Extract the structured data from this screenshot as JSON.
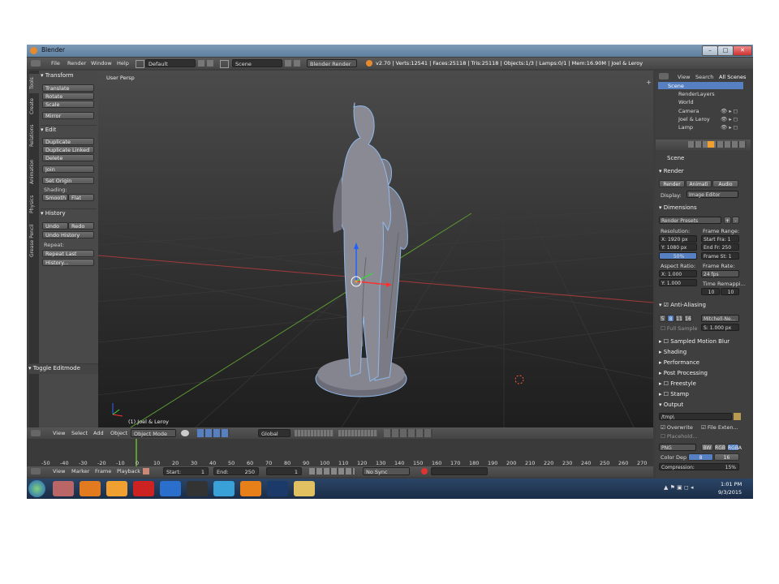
{
  "window": {
    "title": "Blender",
    "buttons": [
      "–",
      "□",
      "✕"
    ]
  },
  "topmenu": {
    "items": [
      "File",
      "Render",
      "Window",
      "Help"
    ],
    "layout": "Default",
    "scene": "Scene",
    "engine": "Blender Render",
    "stats": "v2.70 | Verts:12541 | Faces:25118 | Tris:25118 | Objects:1/3 | Lamps:0/1 | Mem:16.90M | Joel & Leroy"
  },
  "tabs": [
    "Tools",
    "Create",
    "Relations",
    "Animation",
    "Physics",
    "Grease Pencil"
  ],
  "toolshelf": {
    "transform": {
      "header": "Transform",
      "buttons": [
        "Translate",
        "Rotate",
        "Scale",
        "Mirror"
      ]
    },
    "edit": {
      "header": "Edit",
      "buttons": [
        "Duplicate",
        "Duplicate Linked",
        "Delete",
        "Join"
      ],
      "set_origin": "Set Origin",
      "shading_label": "Shading:",
      "smooth": "Smooth",
      "flat": "Flat"
    },
    "history": {
      "header": "History",
      "undo": "Undo",
      "redo": "Redo",
      "undo_history": "Undo History",
      "repeat_label": "Repeat:",
      "repeat_last": "Repeat Last",
      "history_btn": "History..."
    },
    "toggle_editmode": "Toggle Editmode"
  },
  "viewport": {
    "label": "User Persp",
    "object_label": "(1) Joel & Leroy"
  },
  "outliner": {
    "view": "View",
    "search": "Search",
    "all_scenes": "All Scenes",
    "items": [
      "Scene",
      "RenderLayers",
      "World",
      "Camera",
      "Joel & Leroy",
      "Lamp"
    ]
  },
  "properties": {
    "scene": "Scene",
    "render_header": "Render",
    "render_btn": "Render",
    "animation_btn": "Animati",
    "audio_btn": "Audio",
    "display_label": "Display:",
    "display_value": "Image Editor",
    "dimensions_header": "Dimensions",
    "render_presets": "Render Presets",
    "resolution_label": "Resolution:",
    "res_x": "X: 1920 px",
    "res_y": "Y: 1080 px",
    "res_pct": "50%",
    "frame_range_label": "Frame Range:",
    "start_frame": "Start Fra: 1",
    "end_frame": "End Fr: 250",
    "frame_step": "Frame St: 1",
    "aspect_label": "Aspect Ratio:",
    "aspect_x": "X:   1.000",
    "aspect_y": "Y:   1.000",
    "frame_rate_label": "Frame Rate:",
    "fps": "24 fps",
    "time_remap": "Time Remappi...",
    "remap_old": "10",
    "remap_new": "10",
    "aa_header": "Anti-Aliasing",
    "aa_samples": [
      "5",
      "8",
      "11",
      "16"
    ],
    "aa_filter": "Mitchell-Ne...",
    "full_sample": "Full Sample",
    "aa_size": "S: 1.000 px",
    "sections": [
      "Sampled Motion Blur",
      "Shading",
      "Performance",
      "Post Processing",
      "Freestyle",
      "Stamp"
    ],
    "output_header": "Output",
    "output_path": "/tmp\\",
    "overwrite": "Overwrite",
    "file_ext": "File Exten...",
    "placeholders": "Placehold...",
    "format": "PNG",
    "bw": "BW",
    "rgb": "RGB",
    "rgba": "RGBA",
    "color_depth_label": "Color Dep",
    "depth_8": "8",
    "depth_16": "16",
    "compression": "Compression:",
    "compression_value": "15%"
  },
  "vpheader": {
    "items": [
      "View",
      "Select",
      "Add",
      "Object"
    ],
    "mode": "Object Mode",
    "orientation": "Global"
  },
  "timeline": {
    "ticks": [
      "-50",
      "-40",
      "-30",
      "-20",
      "-10",
      "0",
      "10",
      "20",
      "30",
      "40",
      "50",
      "60",
      "70",
      "80",
      "90",
      "100",
      "110",
      "120",
      "130",
      "140",
      "150",
      "160",
      "170",
      "180",
      "190",
      "200",
      "210",
      "220",
      "230",
      "240",
      "250",
      "260",
      "270",
      "280"
    ],
    "current_frame": 1
  },
  "tlheader": {
    "items": [
      "View",
      "Marker",
      "Frame",
      "Playback"
    ],
    "start": "Start:",
    "start_val": "1",
    "end": "End:",
    "end_val": "250",
    "current": "1",
    "sync": "No Sync"
  },
  "taskbar": {
    "time": "1:01 PM",
    "date": "9/3/2015"
  },
  "colors": {
    "accent": "#5680c2",
    "selection": "#f0a030",
    "grid_x": "#a33a3a",
    "grid_y": "#5c9a32"
  }
}
